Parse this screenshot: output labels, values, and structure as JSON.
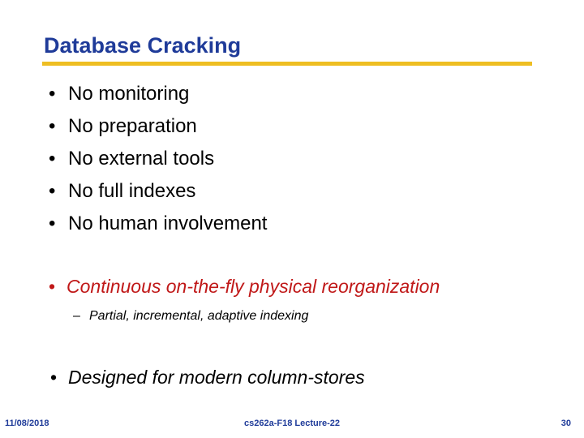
{
  "slide": {
    "title": "Database Cracking",
    "accent_rule_color": "#EEBE22",
    "title_color": "#1F3B99",
    "emphasis_color": "#C01818",
    "bullet_glyph": "•",
    "dash_glyph": "–",
    "bullets": [
      {
        "text": "No monitoring"
      },
      {
        "text": "No preparation"
      },
      {
        "text": "No external tools"
      },
      {
        "text": "No full indexes"
      },
      {
        "text": "No human involvement"
      }
    ],
    "emphasis_bullet": "Continuous on-the-fly physical reorganization",
    "sub_bullet": "Partial, incremental, adaptive indexing",
    "closing_bullet": "Designed for modern column-stores"
  },
  "footer": {
    "date": "11/08/2018",
    "course": "cs262a-F18 Lecture-22",
    "page_number": "30"
  }
}
